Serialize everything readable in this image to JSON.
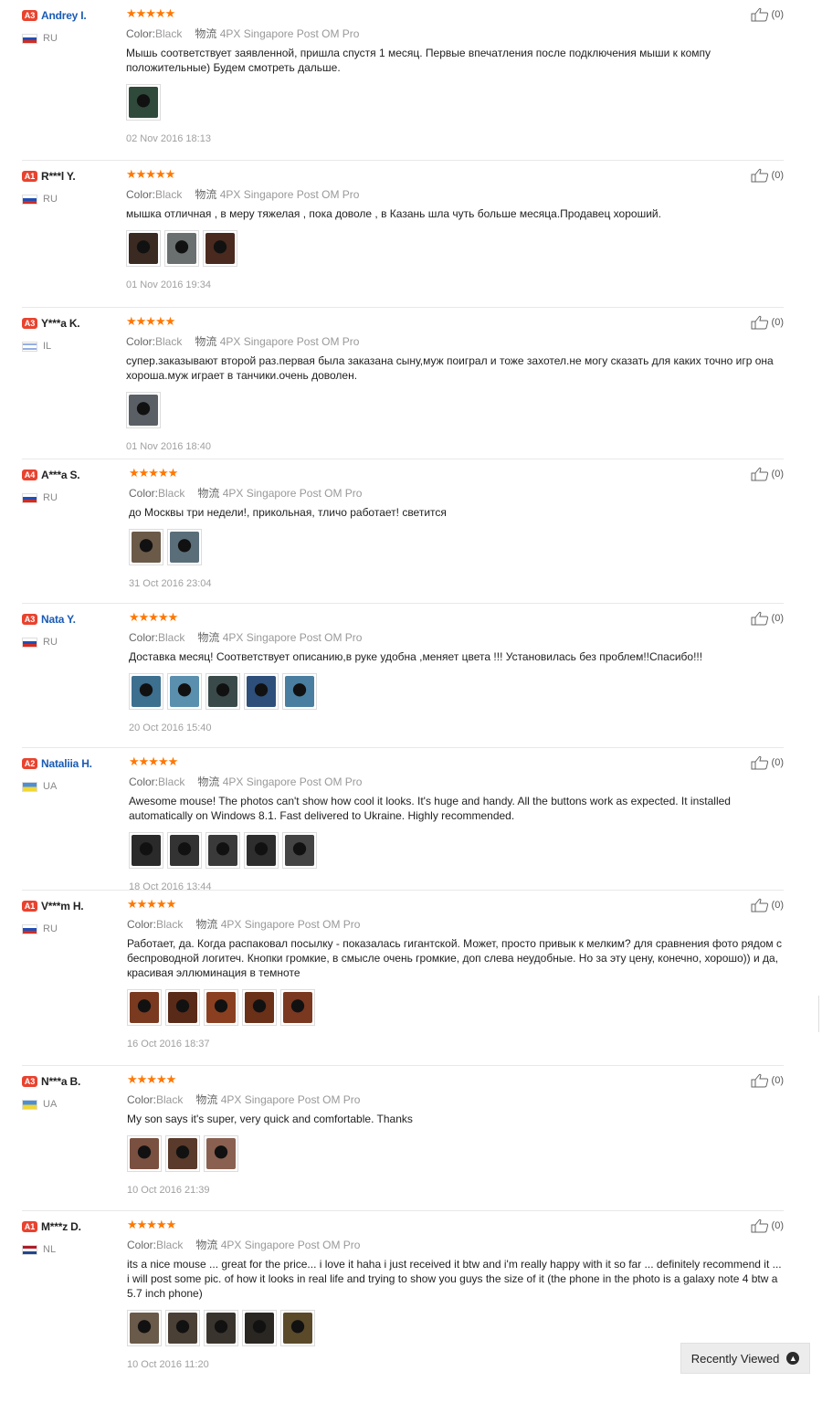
{
  "reviews": [
    {
      "badge": "A3",
      "badge_color": "#e8432f",
      "name": "Andrey I.",
      "name_link": true,
      "country": "RU",
      "flag": "ru",
      "rating": 5,
      "color_label": "Color:",
      "color_value": "Black",
      "shipping_label": "物流",
      "shipping_value": "4PX Singapore Post OM Pro",
      "text": "Мышь соответствует заявленной, пришла спустя 1 месяц. Первые впечатления после подключения мыши к компу положительные) Будем смотреть дальше.",
      "photos": [
        "#2f4a3a"
      ],
      "date": "02 Nov 2016 18:13",
      "helpful": "(0)"
    },
    {
      "badge": "A1",
      "badge_color": "#e8432f",
      "name": "R***l Y.",
      "name_link": false,
      "country": "RU",
      "flag": "ru",
      "rating": 5,
      "color_label": "Color:",
      "color_value": "Black",
      "shipping_label": "物流",
      "shipping_value": "4PX Singapore Post OM Pro",
      "text": "мышка отличная , в меру тяжелая , пока доволе , в Казань шла чуть больше месяца.Продавец хороший.",
      "photos": [
        "#3a2a22",
        "#6a7070",
        "#4a2a1e"
      ],
      "date": "01 Nov 2016 19:34",
      "helpful": "(0)"
    },
    {
      "badge": "A3",
      "badge_color": "#e8432f",
      "name": "Y***a K.",
      "name_link": false,
      "country": "IL",
      "flag": "il",
      "rating": 5,
      "color_label": "Color:",
      "color_value": "Black",
      "shipping_label": "物流",
      "shipping_value": "4PX Singapore Post OM Pro",
      "text": "супер.заказывают второй раз.первая была заказана сыну,муж поиграл и тоже захотел.не могу сказать для каких точно игр она хороша.муж играет в танчики.очень доволен.",
      "photos": [
        "#5a5f66"
      ],
      "date": "01 Nov 2016 18:40",
      "helpful": "(0)"
    },
    {
      "badge": "A4",
      "badge_color": "#e8432f",
      "name": "A***a S.",
      "name_link": false,
      "country": "RU",
      "flag": "ru",
      "rating": 5,
      "color_label": "Color:",
      "color_value": "Black",
      "shipping_label": "物流",
      "shipping_value": "4PX Singapore Post OM Pro",
      "text": "до Москвы три недели!, прикольная, тличо работает! светится",
      "photos": [
        "#6b5a48",
        "#5a6e7a"
      ],
      "date": "31 Oct 2016 23:04",
      "helpful": "(0)"
    },
    {
      "badge": "A3",
      "badge_color": "#e8432f",
      "name": "Nata Y.",
      "name_link": true,
      "country": "RU",
      "flag": "ru",
      "rating": 5,
      "color_label": "Color:",
      "color_value": "Black",
      "shipping_label": "物流",
      "shipping_value": "4PX Singapore Post OM Pro",
      "text": "Доставка месяц! Соответствует описанию,в руке удобна ,меняет цвета !!! Установилась без проблем!!Спасибо!!!",
      "photos": [
        "#3d6f8f",
        "#5a8fae",
        "#3a4a4a",
        "#2d4f7a",
        "#4a7ea0"
      ],
      "date": "20 Oct 2016 15:40",
      "helpful": "(0)"
    },
    {
      "badge": "A2",
      "badge_color": "#e8432f",
      "name": "Nataliia H.",
      "name_link": true,
      "country": "UA",
      "flag": "ua",
      "rating": 5,
      "color_label": "Color:",
      "color_value": "Black",
      "shipping_label": "物流",
      "shipping_value": "4PX Singapore Post OM Pro",
      "text": "Awesome mouse! The photos can't show how cool it looks. It's huge and handy. All the buttons work as expected. It installed automatically on Windows 8.1. Fast delivered to Ukraine. Highly recommended.",
      "photos": [
        "#2a2a2a",
        "#333333",
        "#3a3a3a",
        "#2e2e2e",
        "#444444"
      ],
      "date": "18 Oct 2016 13:44",
      "helpful": "(0)"
    },
    {
      "badge": "A1",
      "badge_color": "#e8432f",
      "name": "V***m H.",
      "name_link": false,
      "country": "RU",
      "flag": "ru",
      "rating": 5,
      "color_label": "Color:",
      "color_value": "Black",
      "shipping_label": "物流",
      "shipping_value": "4PX Singapore Post OM Pro",
      "text": "Работает, да. Когда распаковал посылку - показалась гигантской. Может, просто привык к мелким? для сравнения фото рядом с беспроводной логитеч. Кнопки громкие, в смысле очень громкие, доп слева неудобные. Но за эту цену, конечно, хорошо)) и да, красивая эллюминация в темноте",
      "photos": [
        "#7a3a20",
        "#5a2a18",
        "#8a4020",
        "#6a3018",
        "#7a3820"
      ],
      "date": "16 Oct 2016 18:37",
      "helpful": "(0)"
    },
    {
      "badge": "A3",
      "badge_color": "#e8432f",
      "name": "N***a B.",
      "name_link": false,
      "country": "UA",
      "flag": "ua",
      "rating": 5,
      "color_label": "Color:",
      "color_value": "Black",
      "shipping_label": "物流",
      "shipping_value": "4PX Singapore Post OM Pro",
      "text": "My son says it's super, very quick and comfortable. Thanks",
      "photos": [
        "#7a5040",
        "#5a3a2a",
        "#8a6050"
      ],
      "date": "10 Oct 2016 21:39",
      "helpful": "(0)"
    },
    {
      "badge": "A1",
      "badge_color": "#e8432f",
      "name": "M***z D.",
      "name_link": false,
      "country": "NL",
      "flag": "nl",
      "rating": 5,
      "color_label": "Color:",
      "color_value": "Black",
      "shipping_label": "物流",
      "shipping_value": "4PX Singapore Post OM Pro",
      "text": "its a nice mouse ... great for the price... i love it haha i just received it btw and i'm really happy with it so far ... definitely recommend it ... i will post some pic. of how it looks in real life and trying to show you guys the size of it (the phone in the photo is a galaxy note 4 btw a 5.7 inch phone)",
      "photos": [
        "#6a5a4a",
        "#4a4036",
        "#3a342e",
        "#2a2622",
        "#5a4a2a"
      ],
      "date": "10 Oct 2016 11:20",
      "helpful": "(0)"
    }
  ],
  "recently_viewed": {
    "label": "Recently Viewed",
    "icon": "chevron-up-icon"
  }
}
